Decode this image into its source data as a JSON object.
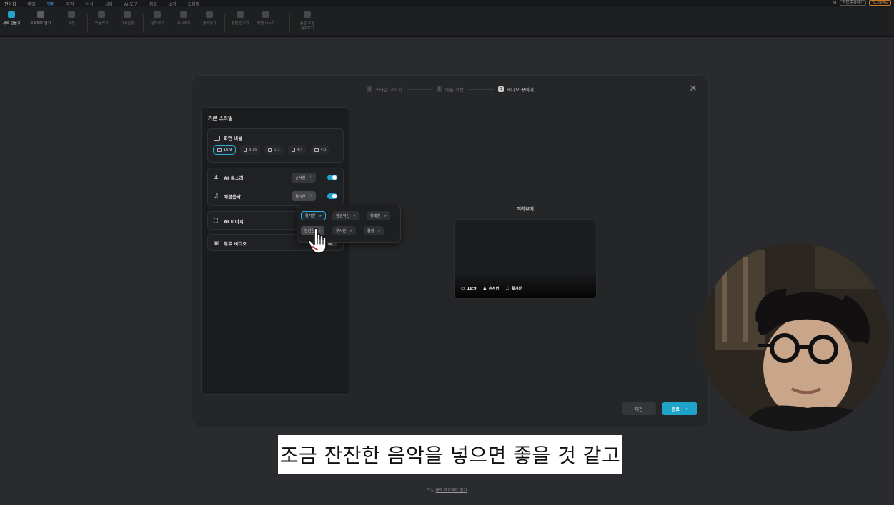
{
  "menubar": {
    "app": "편아짐",
    "items": [
      "파일",
      "편집",
      "자막",
      "서식",
      "삽입",
      "AI 도구",
      "검토",
      "보기",
      "도움말"
    ],
    "active_index": 1,
    "right": [
      "작업 공유하기",
      "업그레이드"
    ]
  },
  "toolbar": {
    "items": [
      {
        "label": "새로 만들기",
        "primary": true
      },
      {
        "label": "프로젝트 열기"
      },
      {
        "label": "재생",
        "dim": true
      },
      {
        "label": "되돌리기",
        "dim": true
      },
      {
        "label": "다시실행",
        "dim": true
      },
      {
        "label": "잘라내기",
        "dim": true
      },
      {
        "label": "복사하기",
        "dim": true
      },
      {
        "label": "붙여넣기",
        "dim": true
      },
      {
        "label": "장면 합치기",
        "dim": true
      },
      {
        "label": "장면 나누기",
        "dim": true
      },
      {
        "label": "음성 표현 찾아보기",
        "dim": true
      }
    ]
  },
  "dialog": {
    "steps": [
      {
        "num": "1",
        "label": "스타일 고르기"
      },
      {
        "num": "2",
        "label": "대본 작성"
      },
      {
        "num": "3",
        "label": "비디오 꾸미기",
        "active": true
      }
    ],
    "close_icon": "close-icon",
    "panel_title": "기본 스타일",
    "aspect": {
      "title": "화면 비율",
      "options": [
        "16:9",
        "9:16",
        "1:1",
        "4:5",
        "4:3"
      ],
      "selected": "16:9"
    },
    "voice": {
      "title": "AI 목소리",
      "value": "손서현",
      "enabled": true
    },
    "music": {
      "title": "배경음악",
      "value": "활기찬",
      "enabled": true
    },
    "ai_image": {
      "title": "AI 이미지"
    },
    "free_video": {
      "title": "무료 비디오",
      "enabled": false
    },
    "music_options": [
      {
        "label": "활기찬",
        "selected": true
      },
      {
        "label": "감성적인"
      },
      {
        "label": "유쾌한"
      },
      {
        "label": "잔잔한",
        "hover": true
      },
      {
        "label": "우서운"
      },
      {
        "label": "웅장"
      }
    ],
    "preview": {
      "title": "미리보기",
      "ratio": "16:9",
      "voice": "손서현",
      "music": "활기찬"
    },
    "prev_button": "이전",
    "done_button": "완료"
  },
  "subtitle": "조금 잔잔한 음악을 넣으면 좋을 것 같고",
  "footer": {
    "prefix": "또는",
    "link": "데모 프로젝트 열기"
  },
  "accent_color": "#1fa3c9"
}
